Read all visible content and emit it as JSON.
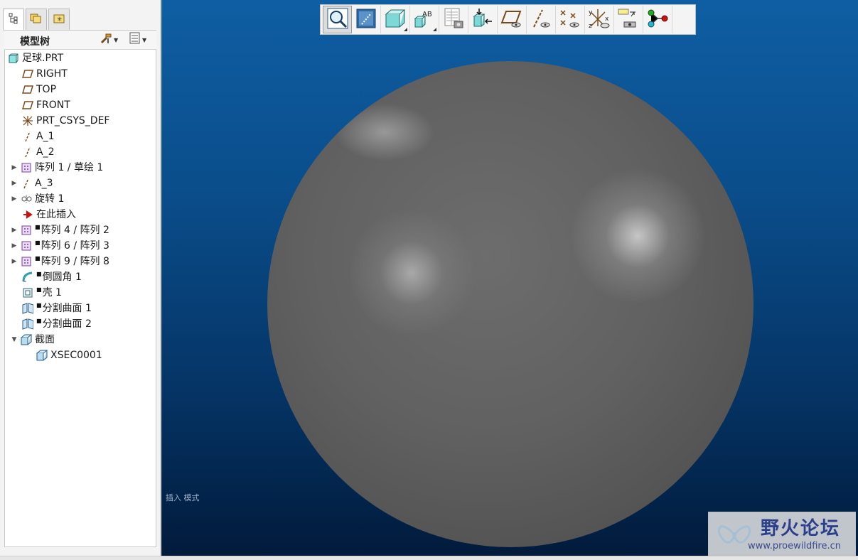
{
  "colors": {
    "viewport_top": "#0f5ea3",
    "viewport_bottom": "#011a3a",
    "sphere": "#5e5e5e",
    "feature_red": "#cc1111"
  },
  "panel": {
    "tabs": [
      {
        "icon": "model-tree-icon"
      },
      {
        "icon": "folder-browser-icon"
      },
      {
        "icon": "favorites-icon"
      }
    ],
    "tree_title": "模型树",
    "settings_icon": "tree-settings-icon",
    "columns_icon": "tree-columns-icon"
  },
  "tree": {
    "items": [
      {
        "label": "足球.PRT",
        "icon": "part-icon"
      },
      {
        "label": "RIGHT",
        "icon": "datum-plane-icon"
      },
      {
        "label": "TOP",
        "icon": "datum-plane-icon"
      },
      {
        "label": "FRONT",
        "icon": "datum-plane-icon"
      },
      {
        "label": "PRT_CSYS_DEF",
        "icon": "coordinate-system-icon"
      },
      {
        "label": "A_1",
        "icon": "datum-axis-icon"
      },
      {
        "label": "A_2",
        "icon": "datum-axis-icon"
      },
      {
        "label": "阵列 1 / 草绘 1",
        "icon": "pattern-icon"
      },
      {
        "label": "A_3",
        "icon": "datum-axis-icon"
      },
      {
        "label": "旋转 1",
        "icon": "revolve-icon"
      },
      {
        "label": "在此插入",
        "icon": "insert-here-arrow-icon"
      },
      {
        "label": "阵列 4 / 阵列 2",
        "icon": "pattern-icon"
      },
      {
        "label": "阵列 6 / 阵列 3",
        "icon": "pattern-icon"
      },
      {
        "label": "阵列 9 / 阵列 8",
        "icon": "pattern-icon"
      },
      {
        "label": "倒圆角 1",
        "icon": "round-icon"
      },
      {
        "label": "壳 1",
        "icon": "shell-icon"
      },
      {
        "label": "分割曲面 1",
        "icon": "split-surface-icon"
      },
      {
        "label": "分割曲面 2",
        "icon": "split-surface-icon"
      },
      {
        "label": "截面",
        "icon": "section-icon"
      },
      {
        "label": "XSEC0001",
        "icon": "section-icon"
      }
    ]
  },
  "toolbar": {
    "buttons": [
      {
        "name": "refit-zoom-icon"
      },
      {
        "name": "repaint-icon"
      },
      {
        "name": "display-style-icon"
      },
      {
        "name": "saved-views-icon"
      },
      {
        "name": "view-manager-icon"
      },
      {
        "name": "reorient-icon"
      },
      {
        "name": "plane-display-icon"
      },
      {
        "name": "axis-display-icon"
      },
      {
        "name": "point-display-icon"
      },
      {
        "name": "csys-display-icon"
      },
      {
        "name": "annotation-display-icon"
      },
      {
        "name": "spin-center-icon"
      }
    ]
  },
  "viewport": {
    "mode_text": "插入 模式"
  },
  "watermark": {
    "title": "野火论坛",
    "url": "www.proewildfire.cn"
  }
}
